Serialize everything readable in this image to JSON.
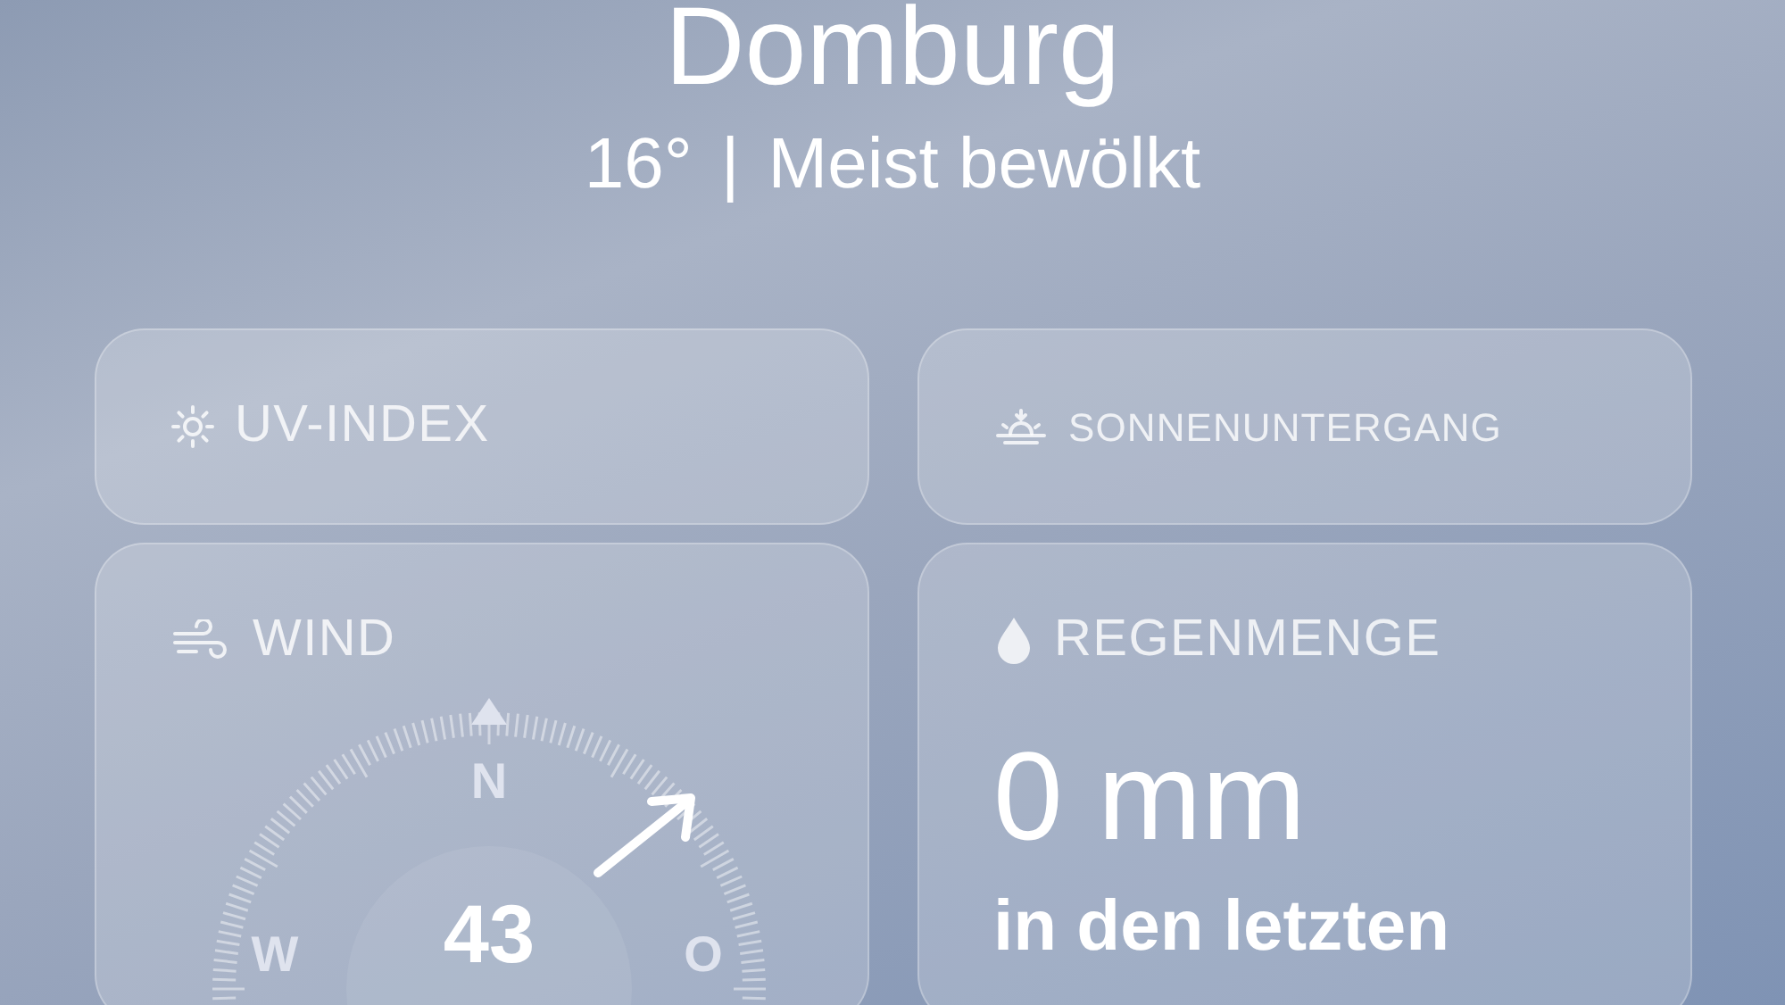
{
  "location": {
    "name": "Domburg",
    "temperature": "16°",
    "separator": "|",
    "condition": "Meist bewölkt"
  },
  "cards": [
    {
      "kind": "uv",
      "title": "UV-INDEX"
    },
    {
      "kind": "sunset",
      "title": "SONNENUNTERGANG"
    },
    {
      "kind": "wind",
      "title": "WIND",
      "north": "N",
      "west": "W",
      "east": "O",
      "speed": "43"
    },
    {
      "kind": "rain",
      "title": "REGENMENGE",
      "amount": "0 mm",
      "period": "in den letzten"
    }
  ]
}
